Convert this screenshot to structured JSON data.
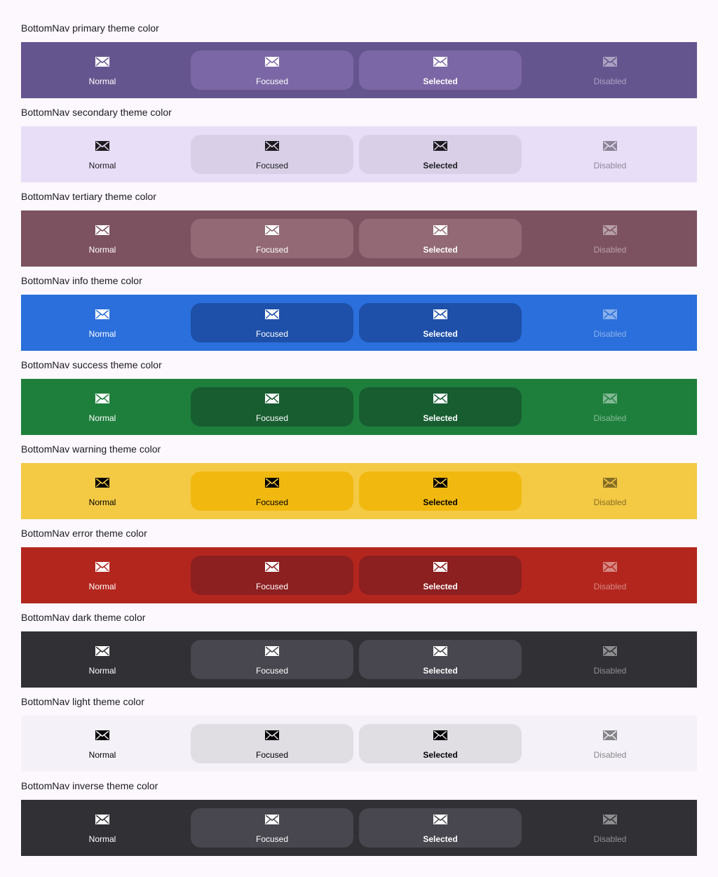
{
  "items": {
    "normal": "Normal",
    "focused": "Focused",
    "selected": "Selected",
    "disabled": "Disabled",
    "icon": "mail-icon"
  },
  "sections": [
    {
      "caption": "BottomNav primary theme color",
      "bg": "#65558f",
      "active": "#7b67a5",
      "fg": "#ffffff"
    },
    {
      "caption": "BottomNav secondary theme color",
      "bg": "#e8def8",
      "active": "#d9d0e7",
      "fg": "#1d1b20"
    },
    {
      "caption": "BottomNav tertiary theme color",
      "bg": "#7d5260",
      "active": "#926974",
      "fg": "#ffffff"
    },
    {
      "caption": "BottomNav info theme color",
      "bg": "#2a6fdb",
      "active": "#1e50a9",
      "fg": "#ffffff"
    },
    {
      "caption": "BottomNav success theme color",
      "bg": "#1e7f3c",
      "active": "#175d30",
      "fg": "#ffffff"
    },
    {
      "caption": "BottomNav warning theme color",
      "bg": "#f4c944",
      "active": "#f1b90f",
      "fg": "#000000"
    },
    {
      "caption": "BottomNav error theme color",
      "bg": "#b3261e",
      "active": "#8c1f20",
      "fg": "#ffffff"
    },
    {
      "caption": "BottomNav dark theme color",
      "bg": "#313034",
      "active": "#48464f",
      "fg": "#ffffff"
    },
    {
      "caption": "BottomNav light theme color",
      "bg": "#f4f2f8",
      "active": "#e0dde3",
      "fg": "#000000"
    },
    {
      "caption": "BottomNav inverse theme color",
      "bg": "#313034",
      "active": "#48464f",
      "fg": "#ffffff"
    }
  ]
}
